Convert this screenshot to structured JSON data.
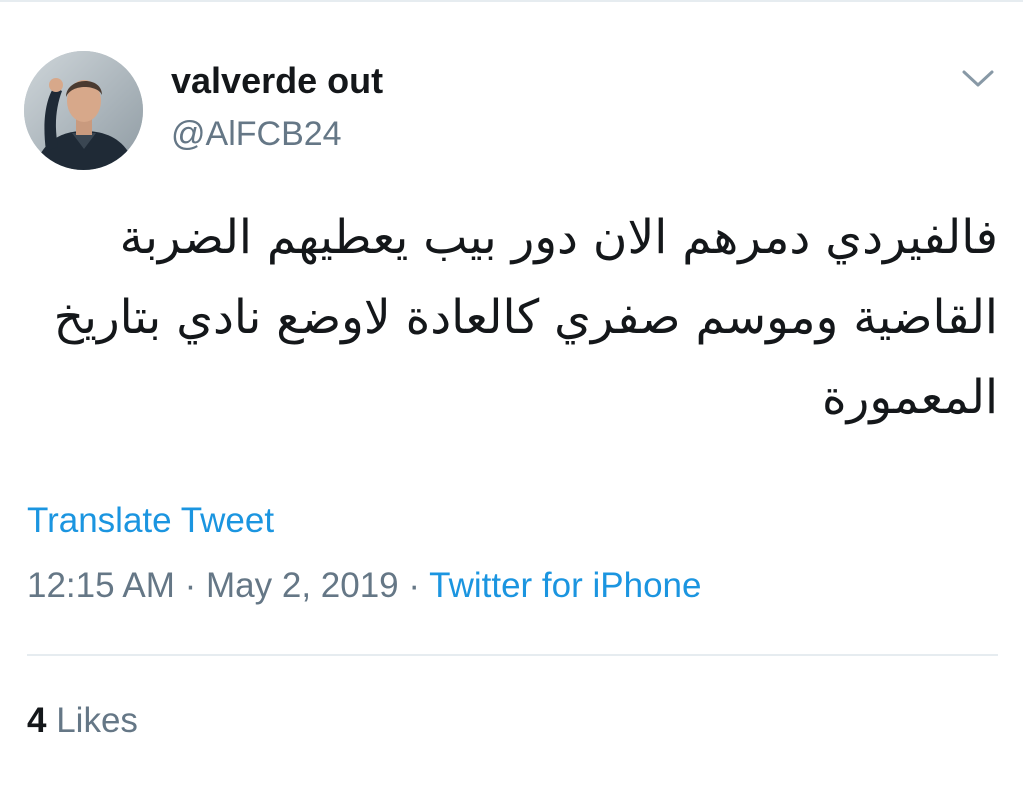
{
  "tweet": {
    "author": {
      "display_name": "valverde out",
      "handle": "@AlFCB24",
      "avatar_icon": "profile-photo"
    },
    "text": "فالفيردي دمرهم الان دور بيب يعطيهم الضربة القاضية وموسم صفري كالعادة لاوضع نادي بتاريخ المعمورة",
    "translate_label": "Translate Tweet",
    "time": "12:15 AM",
    "separator": "·",
    "date": "May 2, 2019",
    "source": "Twitter for iPhone",
    "likes": {
      "count": "4",
      "label": "Likes"
    },
    "menu_icon": "chevron-down-icon"
  },
  "colors": {
    "link": "#1b95e0",
    "secondary_text": "#657786",
    "primary_text": "#14171a",
    "divider": "#e6ecf0"
  }
}
